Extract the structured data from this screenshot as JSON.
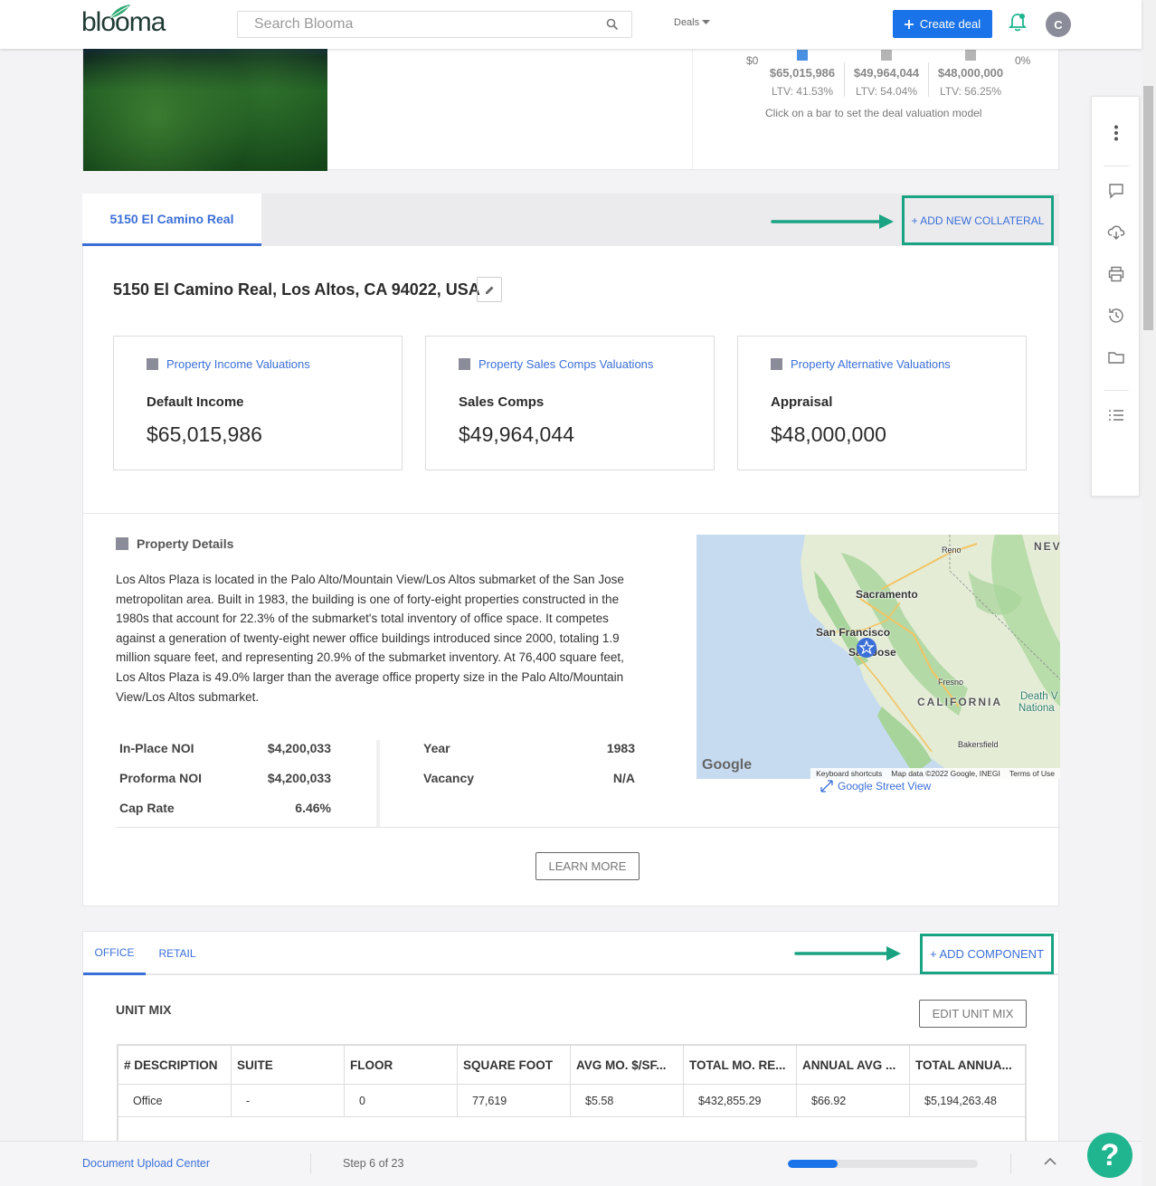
{
  "header": {
    "logo_text": "blooma",
    "search_placeholder": "Search Blooma",
    "deals_label": "Deals",
    "create_deal_label": "Create deal",
    "avatar_initial": "C"
  },
  "valuation_chart": {
    "axis_left": "$0",
    "axis_right": "0%",
    "columns": [
      {
        "amount": "$65,015,986",
        "ltv": "LTV: 41.53%",
        "color": "#4a90e2"
      },
      {
        "amount": "$49,964,044",
        "ltv": "LTV: 54.04%",
        "color": "#b5b5b5"
      },
      {
        "amount": "$48,000,000",
        "ltv": "LTV: 56.25%",
        "color": "#b5b5b5"
      }
    ],
    "hint": "Click on a bar to set the deal valuation model"
  },
  "collateral": {
    "tab_label": "5150 El Camino Real",
    "add_label": "+ ADD NEW COLLATERAL",
    "address": "5150 El Camino Real, Los Altos, CA 94022, USA",
    "valuations": [
      {
        "heading": "Property Income Valuations",
        "label": "Default Income",
        "value": "$65,015,986"
      },
      {
        "heading": "Property Sales Comps Valuations",
        "label": "Sales Comps",
        "value": "$49,964,044"
      },
      {
        "heading": "Property Alternative Valuations",
        "label": "Appraisal",
        "value": "$48,000,000"
      }
    ],
    "details_heading": "Property Details",
    "description": "Los Altos Plaza is located in the Palo Alto/Mountain View/Los Altos submarket of the San Jose metropolitan area. Built in 1983, the building is one of forty-eight properties constructed in the 1980s that account for 22.3% of the submarket's total inventory of office space. It competes against a generation of twenty-eight newer office buildings introduced since 2000, totaling 1.9 million square feet, and representing 20.9% of the submarket inventory. At 76,400 square feet, Los Altos Plaza is 49.0% larger than the average office property size in the Palo Alto/Mountain View/Los Altos submarket.",
    "metrics_left": [
      {
        "key": "In-Place NOI",
        "value": "$4,200,033"
      },
      {
        "key": "Proforma NOI",
        "value": "$4,200,033"
      },
      {
        "key": "Cap Rate",
        "value": "6.46%"
      }
    ],
    "metrics_right": [
      {
        "key": "Year",
        "value": "1983"
      },
      {
        "key": "Vacancy",
        "value": "N/A"
      }
    ],
    "learn_more_label": "LEARN MORE",
    "map": {
      "labels": {
        "reno": "Reno",
        "nev": "NEV",
        "sacramento": "Sacramento",
        "san_francisco": "San Francisco",
        "san_jose": "San Jose",
        "fresno": "Fresno",
        "california": "CALIFORNIA",
        "death_valley": "Death V",
        "national": "Nationa",
        "bakersfield": "Bakersfield"
      },
      "google": "Google",
      "keyboard_shortcuts": "Keyboard shortcuts",
      "map_data": "Map data ©2022 Google, INEGI",
      "terms": "Terms of Use",
      "street_view_label": "Google Street View"
    }
  },
  "components": {
    "tabs": [
      "OFFICE",
      "RETAIL"
    ],
    "add_label": "+ ADD COMPONENT",
    "unit_mix_title": "UNIT MIX",
    "edit_unit_mix_label": "EDIT UNIT MIX",
    "table": {
      "headers": [
        "# DESCRIPTION",
        "SUITE",
        "FLOOR",
        "SQUARE FOOT",
        "AVG MO. $/SF...",
        "TOTAL MO. RE...",
        "ANNUAL AVG ...",
        "TOTAL ANNUA..."
      ],
      "rows": [
        [
          "Office",
          "-",
          "0",
          "77,619",
          "$5.58",
          "$432,855.29",
          "$66.92",
          "$5,194,263.48"
        ]
      ]
    }
  },
  "footer": {
    "doc_upload_label": "Document Upload Center",
    "step_label": "Step 6 of 23",
    "progress_percent": 26
  },
  "colors": {
    "accent": "#3b6fd8",
    "primary_button": "#1a73e8",
    "highlight_border": "#1aa383",
    "help_button": "#20b58f"
  }
}
